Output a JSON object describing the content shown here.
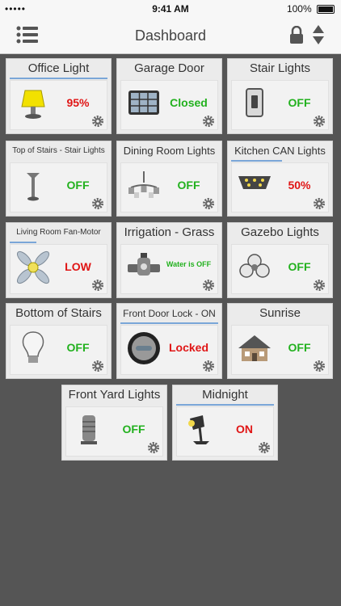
{
  "status_bar": {
    "carrier": "•••••",
    "time": "9:41 AM",
    "battery": "100%"
  },
  "nav": {
    "title": "Dashboard",
    "menu_icon": "list-icon",
    "lock_icon": "lock-icon",
    "sort_icon": "sort-icon"
  },
  "colors": {
    "on_green": "#22b11e",
    "off_red": "#e01515",
    "accent_blue": "#7aa6d8"
  },
  "tiles": [
    {
      "title": "Office Light",
      "status": "95%",
      "icon": "lamp-icon"
    },
    {
      "title": "Garage Door",
      "status": "Closed",
      "icon": "garage-door-icon"
    },
    {
      "title": "Stair Lights",
      "status": "OFF",
      "icon": "wall-switch-icon"
    },
    {
      "title": "Top of Stairs - Stair Lights",
      "status": "OFF",
      "icon": "floor-lamp-icon"
    },
    {
      "title": "Dining Room Lights",
      "status": "OFF",
      "icon": "chandelier-icon"
    },
    {
      "title": "Kitchen CAN Lights",
      "status": "50%",
      "icon": "can-lights-icon"
    },
    {
      "title": "Living Room Fan-Motor",
      "status": "LOW",
      "icon": "fan-icon"
    },
    {
      "title": "Irrigation - Grass",
      "status": "Water is OFF",
      "icon": "sprinkler-valve-icon"
    },
    {
      "title": "Gazebo Lights",
      "status": "OFF",
      "icon": "ceiling-fixture-icon"
    },
    {
      "title": "Bottom of Stairs",
      "status": "OFF",
      "icon": "bulb-icon"
    },
    {
      "title": "Front Door Lock - ON",
      "status": "Locked",
      "icon": "door-lock-icon"
    },
    {
      "title": "Sunrise",
      "status": "OFF",
      "icon": "house-icon"
    },
    {
      "title": "Front Yard Lights",
      "status": "OFF",
      "icon": "post-light-icon"
    },
    {
      "title": "Midnight",
      "status": "ON",
      "icon": "spotlight-icon"
    }
  ]
}
